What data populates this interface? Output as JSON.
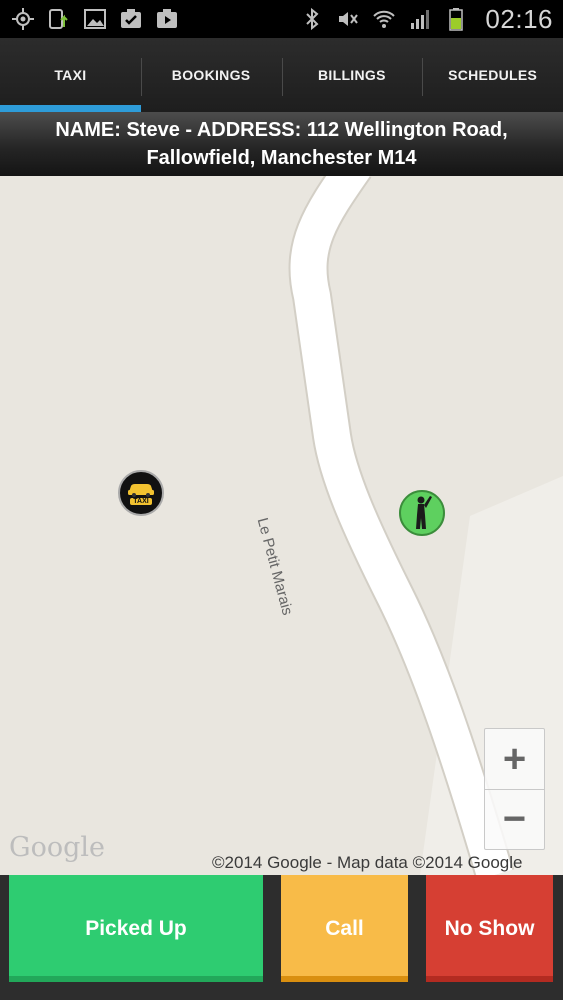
{
  "status_bar": {
    "time": "02:16",
    "left_icons": [
      "gps-icon",
      "upload-icon",
      "image-icon",
      "check-icon",
      "play-store-icon"
    ],
    "right_icons": [
      "bluetooth-icon",
      "mute-icon",
      "wifi-icon",
      "signal-icon",
      "battery-icon"
    ]
  },
  "tabs": [
    {
      "label": "TAXI",
      "active": true
    },
    {
      "label": "BOOKINGS",
      "active": false
    },
    {
      "label": "BILLINGS",
      "active": false
    },
    {
      "label": "SCHEDULES",
      "active": false
    }
  ],
  "banner": {
    "line1": "NAME: Steve - ADDRESS: 112 Wellington Road,",
    "line2": "Fallowfield, Manchester M14"
  },
  "map": {
    "street_name": "Le Petit Marais",
    "taxi_label": "TAXI",
    "zoom_in": "+",
    "zoom_out": "−",
    "logo": "Google",
    "copyright": "©2014 Google - Map data ©2014 Google"
  },
  "actions": {
    "picked_up": "Picked Up",
    "call": "Call",
    "no_show": "No Show"
  },
  "colors": {
    "tab_indicator": "#2e9cd9",
    "picked_up": "#2ecc71",
    "call": "#f8bb48",
    "no_show": "#d63f33",
    "map_bg": "#e9e6df"
  }
}
